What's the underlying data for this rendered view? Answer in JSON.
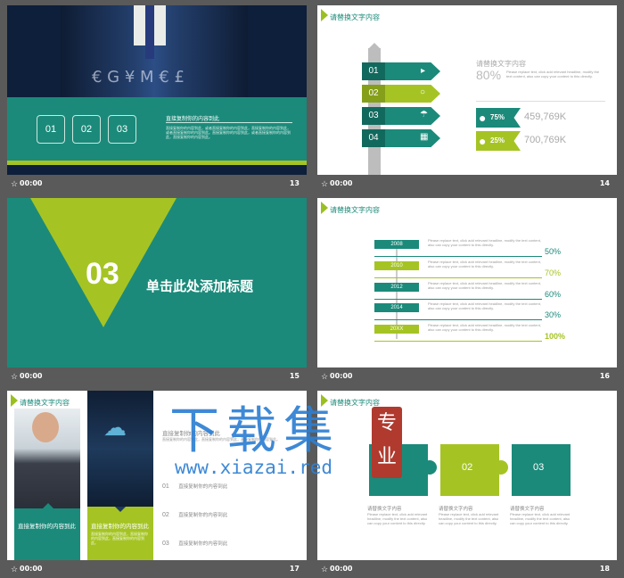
{
  "colors": {
    "teal": "#1b8a7a",
    "lime": "#a5c424",
    "dark": "#0d1f3a"
  },
  "common": {
    "time": "00:00",
    "star": "☆"
  },
  "s13": {
    "number": "13",
    "boxes": [
      "01",
      "02",
      "03"
    ],
    "title": "直接复制你的内容到此",
    "body": "直接复制你的内容到此，或者直接复制你的内容到此，直接复制你的内容到此，或者直接复制你的内容到此。直接复制你的内容到此，或者直接复制你的内容到此，直接复制你的内容到此。"
  },
  "s14": {
    "number": "14",
    "header": "请替换文字内容",
    "tags": [
      "01",
      "02",
      "03",
      "04"
    ],
    "stat_title": "请替换文字内容",
    "stat_pct": "80%",
    "stat_body": "Please replace text, click add relevant headline, modify the text content, also can copy your content to this directly.",
    "rows": [
      {
        "pct": "75%",
        "val": "459,769K"
      },
      {
        "pct": "25%",
        "val": "700,769K"
      }
    ]
  },
  "s15": {
    "number": "15",
    "big": "03",
    "title": "单击此处添加标题"
  },
  "s16": {
    "number": "16",
    "header": "请替换文字内容",
    "years": [
      "2008",
      "2010",
      "2012",
      "2014",
      "20XX"
    ],
    "pcts": [
      "50%",
      "70%",
      "60%",
      "30%",
      "100%"
    ],
    "body": "Please replace text, click add relevant headline, modify the text content, also can copy your content to this directly."
  },
  "s17": {
    "number": "17",
    "header": "请替换文字内容",
    "cap1": "直接复制你的内容到此",
    "cap2": "直接复制你的内容到此",
    "title": "直接复制你的内容到此",
    "items": [
      {
        "n": "01",
        "t": "直接复制你的内容到此"
      },
      {
        "n": "02",
        "t": "直接复制你的内容到此"
      },
      {
        "n": "03",
        "t": "直接复制你的内容到此"
      }
    ],
    "body": "直接复制你的内容到此，直接复制你的内容到此，直接复制你的内容到此。"
  },
  "s18": {
    "number": "18",
    "header": "请替换文字内容",
    "pieces": [
      "01",
      "02",
      "03"
    ],
    "cap": "请替换文字内容",
    "body": "Please replace text, click add relevant headline, modify the text content, also can copy your content to this directly."
  },
  "watermark": {
    "title": "下载集",
    "url": "www.xiazai.red",
    "seal": "专业"
  }
}
